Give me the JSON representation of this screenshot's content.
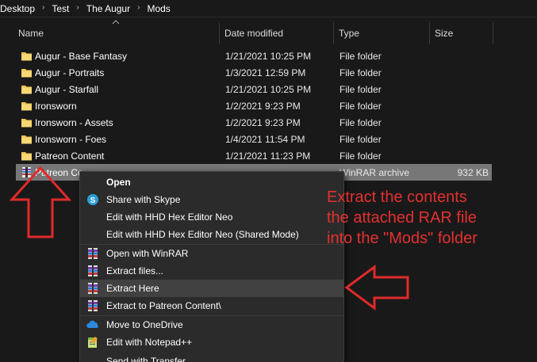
{
  "breadcrumb": {
    "items": [
      "Desktop",
      "Test",
      "The Augur",
      "Mods"
    ],
    "separator": "›"
  },
  "columns": {
    "name": "Name",
    "date": "Date modified",
    "type": "Type",
    "size": "Size"
  },
  "files": [
    {
      "name": "Augur - Base Fantasy",
      "date": "1/21/2021 10:25 PM",
      "type": "File folder",
      "size": "",
      "icon": "folder-icon"
    },
    {
      "name": "Augur - Portraits",
      "date": "1/3/2021 12:59 PM",
      "type": "File folder",
      "size": "",
      "icon": "folder-icon"
    },
    {
      "name": "Augur - Starfall",
      "date": "1/21/2021 10:25 PM",
      "type": "File folder",
      "size": "",
      "icon": "folder-icon"
    },
    {
      "name": "Ironsworn",
      "date": "1/2/2021 9:23 PM",
      "type": "File folder",
      "size": "",
      "icon": "folder-icon"
    },
    {
      "name": "Ironsworn - Assets",
      "date": "1/2/2021 9:23 PM",
      "type": "File folder",
      "size": "",
      "icon": "folder-icon"
    },
    {
      "name": "Ironsworn - Foes",
      "date": "1/4/2021 11:54 PM",
      "type": "File folder",
      "size": "",
      "icon": "folder-icon"
    },
    {
      "name": "Patreon Content",
      "date": "1/21/2021 11:23 PM",
      "type": "File folder",
      "size": "",
      "icon": "folder-icon"
    },
    {
      "name": "Patreon Co",
      "date": "",
      "type": "WinRAR archive",
      "size": "932 KB",
      "icon": "rar-archive-icon"
    }
  ],
  "context_menu": {
    "items": [
      {
        "label": "Open",
        "icon": "",
        "bold": true
      },
      {
        "label": "Share with Skype",
        "icon": "skype-icon"
      },
      {
        "label": "Edit with HHD Hex Editor Neo",
        "icon": ""
      },
      {
        "label": "Edit with HHD Hex Editor Neo (Shared Mode)",
        "icon": ""
      },
      {
        "label": "Open with WinRAR",
        "icon": "winrar-icon"
      },
      {
        "label": "Extract files...",
        "icon": "winrar-icon"
      },
      {
        "label": "Extract Here",
        "icon": "winrar-icon",
        "hover": true
      },
      {
        "label": "Extract to Patreon Content\\",
        "icon": "winrar-icon"
      },
      {
        "label": "Move to OneDrive",
        "icon": "onedrive-icon"
      },
      {
        "label": "Edit with Notepad++",
        "icon": "notepadpp-icon"
      },
      {
        "label": "Send with Transfer",
        "icon": ""
      }
    ]
  },
  "annotation": {
    "lines": [
      "Extract the contents",
      "the attached RAR file",
      "into the \"Mods\" folder"
    ],
    "color": "#e53030"
  },
  "colors": {
    "background": "#191919",
    "selected_row": "#777777",
    "menu_bg": "#2b2b2b",
    "menu_hover": "#414141",
    "folder": "#f1c44e",
    "annotation": "#e53030"
  }
}
